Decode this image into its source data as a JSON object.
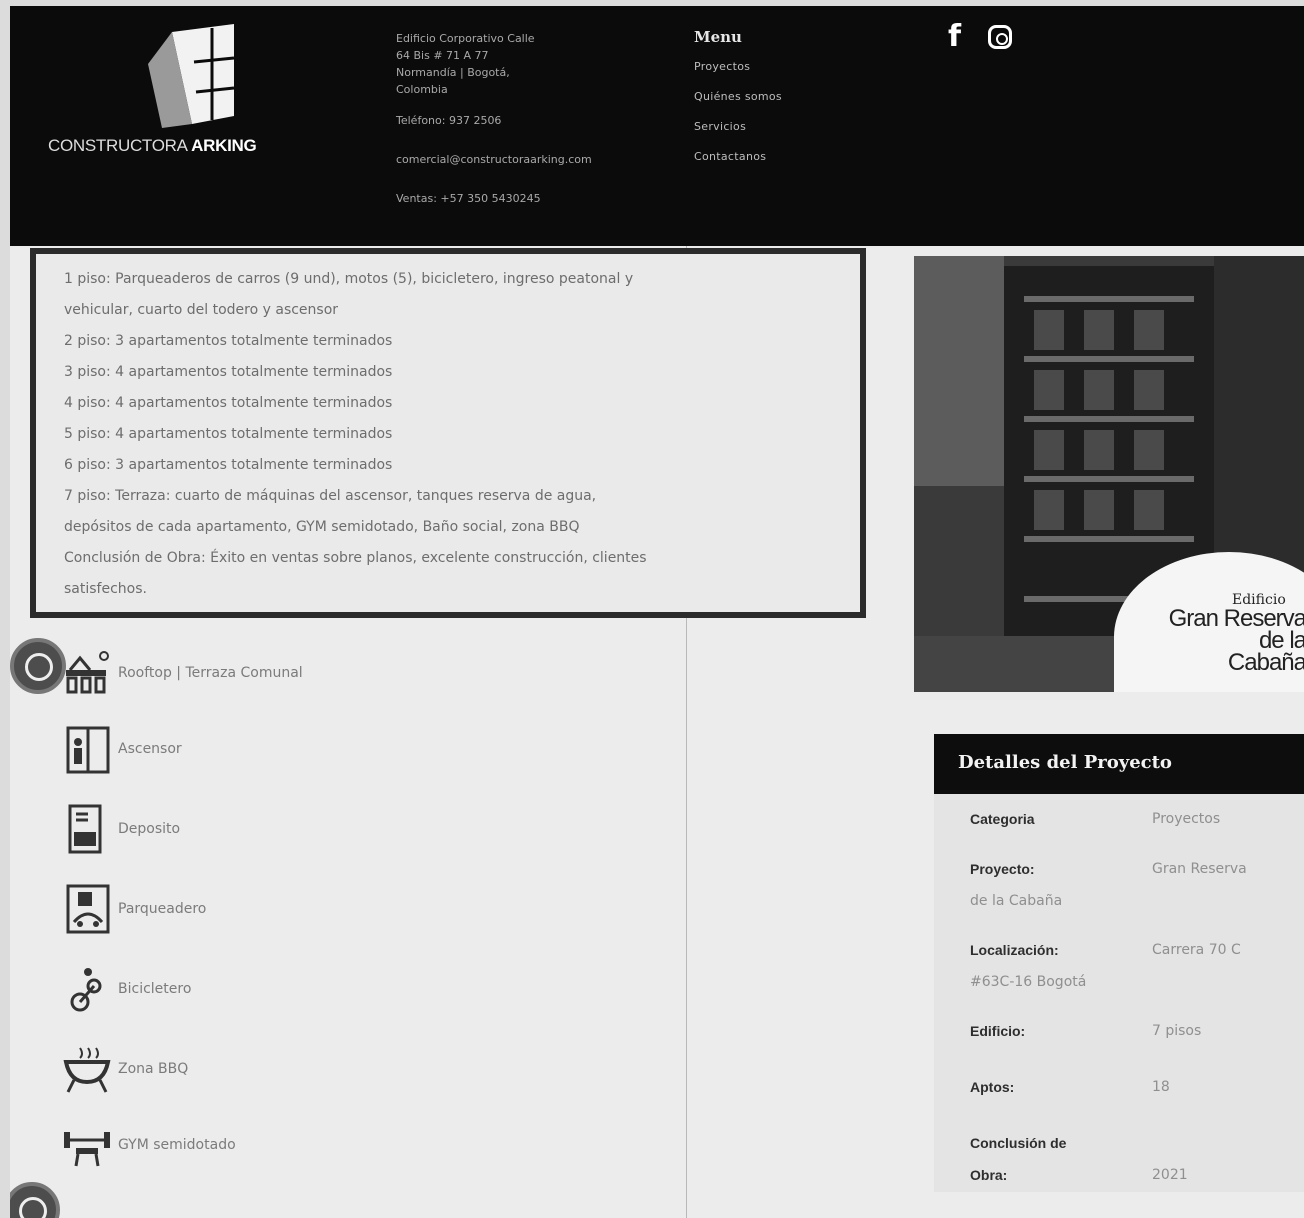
{
  "header": {
    "logo": {
      "brand_light": "CONSTRUCTORA",
      "brand_bold": "ARKING"
    },
    "contact": {
      "address_lines": [
        "Edificio Corporativo Calle",
        "64 Bis # 71 A 77",
        "Normandía | Bogotá,",
        "Colombia"
      ],
      "phone": "Teléfono: 937 2506",
      "email": "comercial@constructoraarking.com",
      "sales": "Ventas: +57 350 5430245"
    },
    "menu": {
      "title": "Menu",
      "items": [
        "Proyectos",
        "Quiénes somos",
        "Servicios",
        "Contactanos"
      ]
    },
    "social": [
      "facebook-icon",
      "instagram-icon"
    ]
  },
  "description": [
    "1 piso: Parqueaderos de carros (9 und), motos (5), bicicletero, ingreso peatonal y",
    "vehicular, cuarto del todero y ascensor",
    "2 piso: 3 apartamentos totalmente terminados",
    "3 piso: 4 apartamentos totalmente terminados",
    "4 piso: 4 apartamentos totalmente terminados",
    "5 piso: 4 apartamentos totalmente terminados",
    "6 piso: 3 apartamentos totalmente terminados",
    "7 piso: Terraza: cuarto de máquinas del ascensor, tanques reserva de agua,",
    "depósitos de cada apartamento, GYM semidotado, Baño social, zona BBQ",
    "Conclusión de Obra: Éxito en ventas sobre planos, excelente construcción, clientes",
    "satisfechos."
  ],
  "amenities": [
    {
      "label": "Rooftop | Terraza Comunal",
      "icon": "rooftop-icon"
    },
    {
      "label": "Ascensor",
      "icon": "elevator-icon"
    },
    {
      "label": "Deposito",
      "icon": "storage-icon"
    },
    {
      "label": "Parqueadero",
      "icon": "parking-icon"
    },
    {
      "label": "Bicicletero",
      "icon": "bicycle-icon"
    },
    {
      "label": "Zona BBQ",
      "icon": "bbq-icon"
    },
    {
      "label": "GYM semidotado",
      "icon": "gym-icon"
    }
  ],
  "photo_badge": {
    "small": "Edificio",
    "lines": [
      "Gran Reserva",
      "de la",
      "Cabaña"
    ]
  },
  "details": {
    "title": "Detalles del Proyecto",
    "rows": [
      {
        "key": "Categoria",
        "value": "Proyectos"
      },
      {
        "key": "Proyecto:",
        "value": "Gran Reserva",
        "cont": "de la Cabaña"
      },
      {
        "key": "Localización:",
        "value": "Carrera 70 C",
        "cont": "#63C-16 Bogotá"
      },
      {
        "key": "Edificio:",
        "value": "7 pisos"
      },
      {
        "key": "Aptos:",
        "value": "18"
      },
      {
        "key": "Conclusión de",
        "value": "",
        "cont_key": "Obra:",
        "cont_value": "2021"
      }
    ]
  },
  "colors": {
    "header_bg": "#0b0b0b",
    "panel_head_bg": "#0d0d0d",
    "page_bg": "#ececec"
  }
}
